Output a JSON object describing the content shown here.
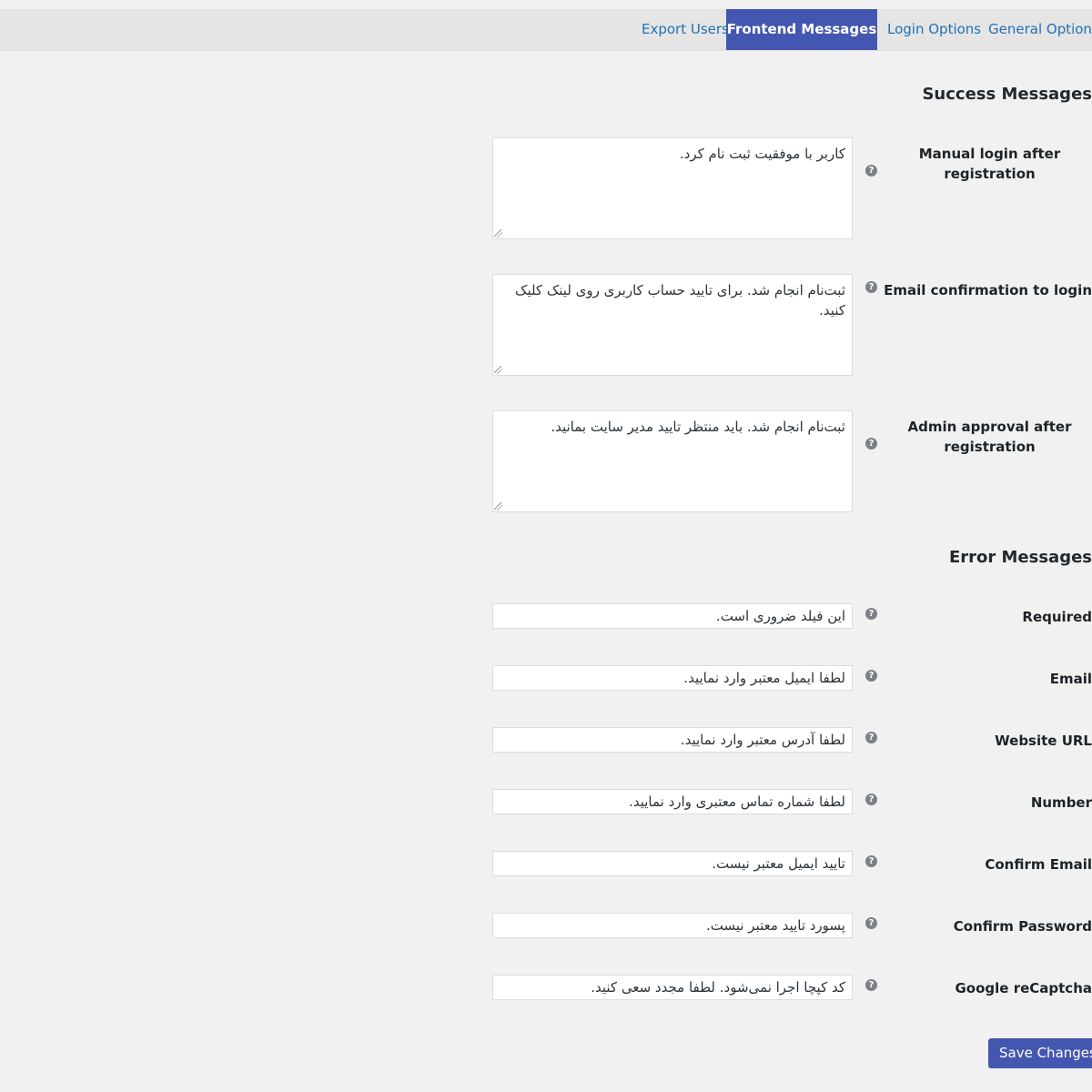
{
  "tabs": [
    {
      "label": "Export Users"
    },
    {
      "label": "Frontend Messages"
    },
    {
      "label": "Login Options"
    },
    {
      "label": "General Options"
    }
  ],
  "success": {
    "title": "Success Messages",
    "rows": [
      {
        "label": "Manual login after registration",
        "value": "کاربر با موفقیت ثبت نام کرد."
      },
      {
        "label": "Email confirmation to login",
        "value": "ثبت‌نام انجام شد. برای تایید حساب کاربری روی لینک کلیک کنید."
      },
      {
        "label": "Admin approval after registration",
        "value": "ثبت‌نام انجام شد. باید منتظر تایید مدیر سایت بمانید."
      }
    ]
  },
  "error": {
    "title": "Error Messages",
    "rows": [
      {
        "label": "Required",
        "value": "این فیلد ضروری است."
      },
      {
        "label": "Email",
        "value": "لطفا ایمیل معتبر وارد نمایید."
      },
      {
        "label": "Website URL",
        "value": "لطفا آدرس معتبر وارد نمایید."
      },
      {
        "label": "Number",
        "value": "لطفا شماره تماس معتبری وارد نمایید."
      },
      {
        "label": "Confirm Email",
        "value": "تایید ایمیل معتبر نیست."
      },
      {
        "label": "Confirm Password",
        "value": "پسورد تایید معتبر نیست."
      },
      {
        "label": "Google reCaptcha",
        "value": "کد کپچا اجرا نمی‌شود. لطفا مجدد سعی کنید."
      }
    ]
  },
  "help_glyph": "?",
  "save_label": "Save Changes",
  "colors": {
    "accent": "#4457b0",
    "link": "#2271b1",
    "background": "#f1f1f1"
  }
}
